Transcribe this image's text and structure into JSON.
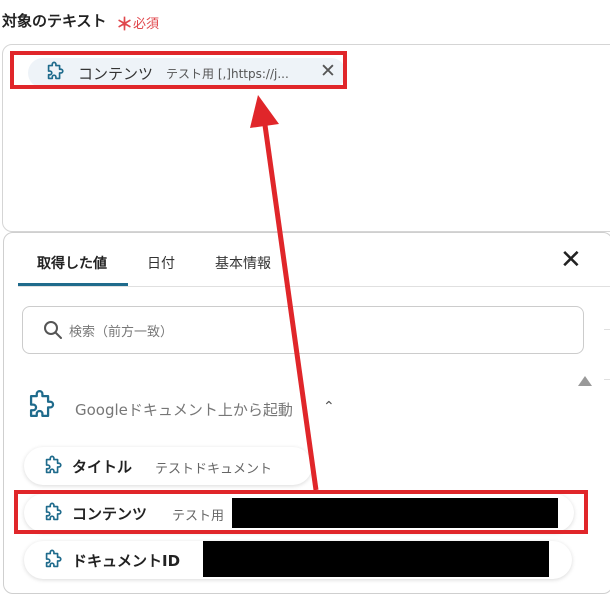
{
  "field": {
    "label": "対象のテキスト",
    "required_mark": "＊",
    "required_text": "必須"
  },
  "chip": {
    "label": "コンテンツ",
    "sublabel": "テスト用 [,]https://j...",
    "remove": "✕"
  },
  "dropdown": {
    "tabs": [
      "取得した値",
      "日付",
      "基本情報"
    ],
    "active_tab_index": 0,
    "close": "✕",
    "search_placeholder": "検索（前方一致）",
    "group_title": "Googleドキュメント上から起動",
    "group_chevron": "⌃",
    "items": [
      {
        "label": "タイトル",
        "sublabel": "テストドキュメント"
      },
      {
        "label": "コンテンツ",
        "sublabel": "テスト用"
      },
      {
        "label": "ドキュメントID",
        "sublabel": ""
      }
    ]
  },
  "colors": {
    "accent": "#1f6b8c",
    "required": "#e0474c",
    "highlight": "#e0262a",
    "icon": "#1f6b8c"
  }
}
